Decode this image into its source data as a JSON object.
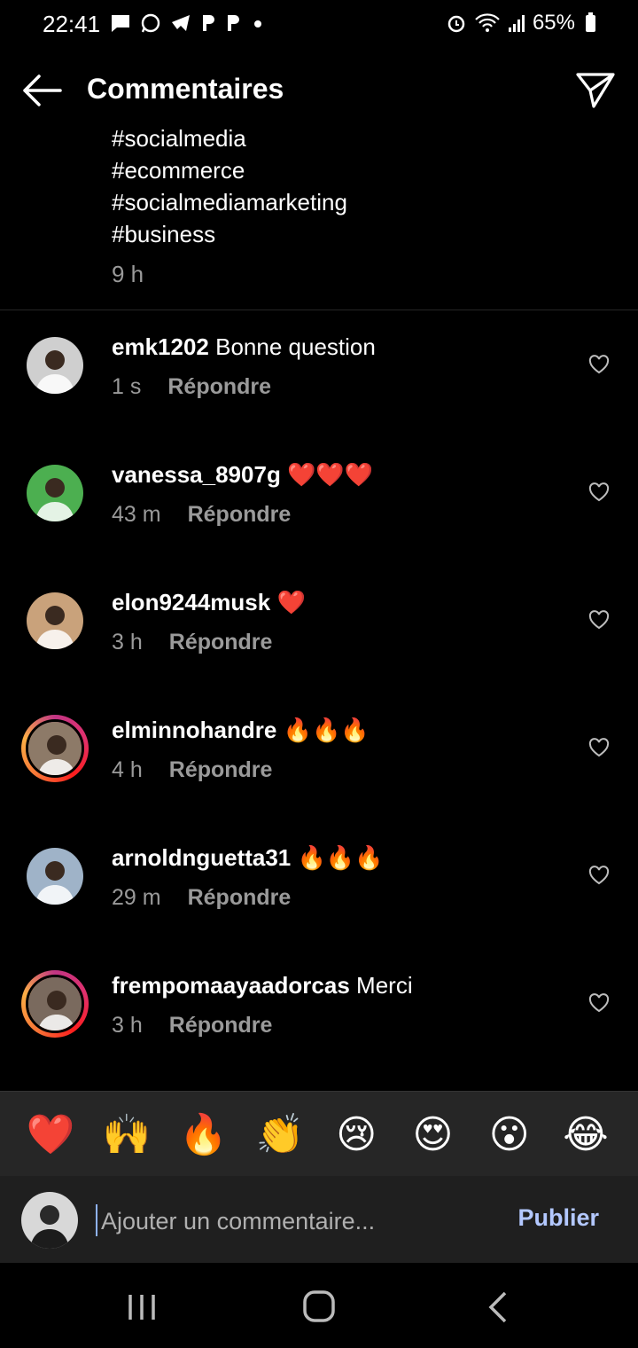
{
  "status_bar": {
    "time": "22:41",
    "battery": "65%",
    "left_icons": [
      "message-icon",
      "whatsapp-icon",
      "telegram-icon",
      "p-icon",
      "p-icon",
      "dot-icon"
    ],
    "right_icons": [
      "alarm-icon",
      "wifi-icon",
      "signal-icon",
      "battery-icon"
    ]
  },
  "header": {
    "title": "Commentaires"
  },
  "caption": {
    "hashtags": [
      "#socialmedia",
      "#ecommerce",
      "#socialmediamarketing",
      "#business"
    ],
    "time": "9 h"
  },
  "comments": [
    {
      "user": "emk1202",
      "text": " Bonne question",
      "time": "1 s",
      "reply": "Répondre",
      "avatar_color": "#cfcfcf",
      "story_ring": false
    },
    {
      "user": "vanessa_8907g",
      "text": " ❤️❤️❤️",
      "time": "43 m",
      "reply": "Répondre",
      "avatar_color": "#4caf50",
      "story_ring": false
    },
    {
      "user": "elon9244musk",
      "text": " ❤️",
      "time": "3 h",
      "reply": "Répondre",
      "avatar_color": "#c9a27b",
      "story_ring": false
    },
    {
      "user": "elminnohandre",
      "text": " 🔥🔥🔥",
      "time": "4 h",
      "reply": "Répondre",
      "avatar_color": "#8d7a68",
      "story_ring": true
    },
    {
      "user": "arnoldnguetta31",
      "text": " 🔥🔥🔥",
      "time": "29 m",
      "reply": "Répondre",
      "avatar_color": "#9fb3c8",
      "story_ring": false
    },
    {
      "user": "frempomaayaadorcas",
      "text": " Merci",
      "time": "3 h",
      "reply": "Répondre",
      "avatar_color": "#7a6a5e",
      "story_ring": true
    }
  ],
  "emoji_bar": [
    "❤️",
    "🙌",
    "🔥",
    "👏",
    "😢",
    "😍",
    "😮",
    "😂"
  ],
  "compose": {
    "placeholder": "Ajouter un commentaire...",
    "publish": "Publier"
  }
}
